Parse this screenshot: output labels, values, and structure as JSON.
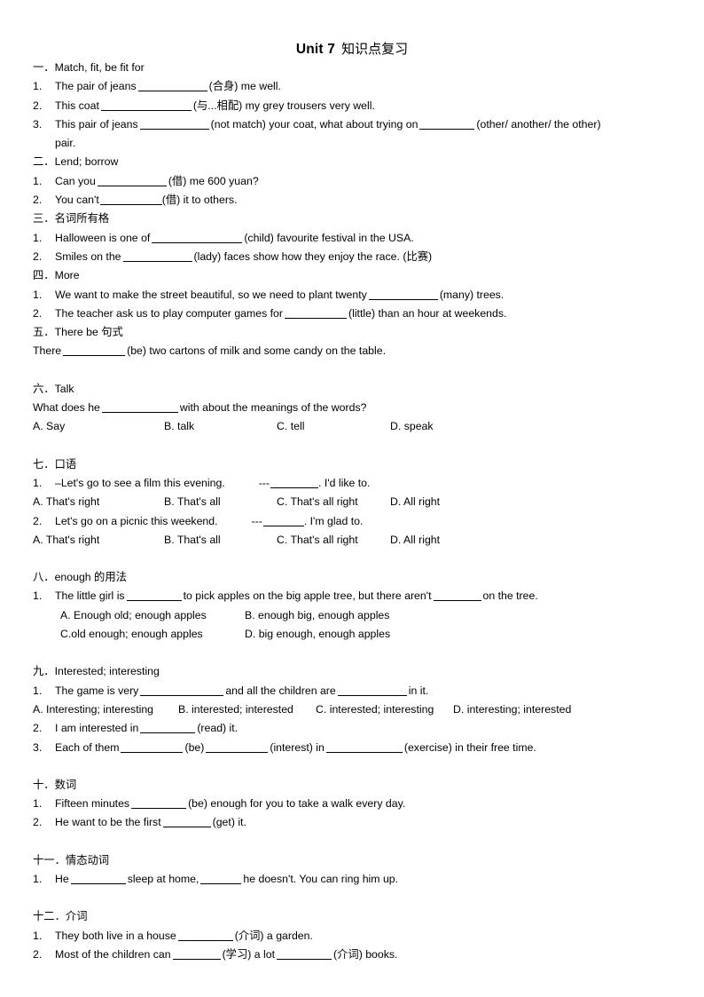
{
  "title": {
    "en": "Unit 7",
    "cn": "知识点复习"
  },
  "sections": [
    {
      "id": "sec-1",
      "heading": "一．Match, fit, be fit for",
      "items": [
        {
          "num": "1.",
          "pre": "The pair of jeans",
          "post": "(合身) me well.",
          "blank": "b10"
        },
        {
          "num": "2.",
          "pre": "This coat",
          "post": "(与...相配) my grey trousers very well.",
          "blank": "b13"
        },
        {
          "num": "3.",
          "pre": "This pair of jeans",
          "mid": "(not match) your coat, what about trying on",
          "post": "(other/ another/ the other)",
          "wrap": "pair.",
          "blank": "b10",
          "blank2": "b8"
        }
      ]
    },
    {
      "id": "sec-2",
      "heading": "二．Lend; borrow",
      "items": [
        {
          "num": "1.",
          "pre": "Can you",
          "post": "(借) me 600 yuan?",
          "blank": "b10"
        },
        {
          "num": "2.",
          "pre": "You can't",
          "post": "(借) it to others.",
          "blank": "b9"
        }
      ]
    },
    {
      "id": "sec-3",
      "heading": "三．名词所有格",
      "items": [
        {
          "num": "1.",
          "pre": "Halloween is one of",
          "post": "(child) favourite festival in the USA.",
          "blank": "b13"
        },
        {
          "num": "2.",
          "pre": "Smiles on the",
          "post": "(lady) faces show how they enjoy the race. (比赛)",
          "blank": "b10"
        }
      ]
    },
    {
      "id": "sec-4",
      "heading": "四．More",
      "items": [
        {
          "num": "1.",
          "pre": "We want to make the street beautiful, so we need to plant twenty",
          "post": "(many) trees.",
          "blank": "b10"
        },
        {
          "num": "2.",
          "pre": "The teacher ask us to play computer games for",
          "post": "(little) than an hour at weekends.",
          "blank": "b9"
        }
      ]
    },
    {
      "id": "sec-5",
      "heading": "五．There be 句式",
      "plain": {
        "pre": "There",
        "post": "(be) two cartons of milk and some candy on the table.",
        "blank": "b9"
      }
    },
    {
      "id": "sec-6",
      "heading": "六．Talk",
      "plain": {
        "pre": "What does he",
        "post": "with about the meanings of the words?",
        "blank": "b11"
      },
      "options": [
        "A.  Say",
        "B. talk",
        "C. tell",
        "D. speak"
      ]
    },
    {
      "id": "sec-7",
      "heading": "七．口语",
      "q1": {
        "num": "1.",
        "pre": "–Let's go to see a film this evening.",
        "dash": "---",
        "post": ". I'd like to.",
        "blank": "b7"
      },
      "options1": [
        "A.  That's right",
        "B. That's all",
        "C. That's all right",
        "D. All right"
      ],
      "q2": {
        "num": "2.",
        "pre": "Let's go on a picnic this weekend.",
        "dash": "---",
        "post": ". I'm glad to.",
        "blank": "b6"
      },
      "options2": [
        "A.  That's right",
        "B. That's all",
        "C. That's all right",
        "D. All right"
      ]
    },
    {
      "id": "sec-8",
      "heading": "八．enough 的用法",
      "q1": {
        "num": "1.",
        "pre": "The little girl is",
        "mid": "to pick apples on the big apple tree, but there aren't",
        "post": "on the tree.",
        "blank": "b8",
        "blank2": "b7"
      },
      "opt_row1_left": "A.  Enough old; enough apples",
      "opt_row1_right": "B. enough big, enough apples",
      "opt_row2_left": "C.old enough; enough apples",
      "opt_row2_right": "D. big enough, enough apples"
    },
    {
      "id": "sec-9",
      "heading": "九．Interested; interesting",
      "q1": {
        "num": "1.",
        "pre": "The game is very",
        "mid": "and all the children are",
        "post": "in it.",
        "blank": "b12",
        "blank2": "b10"
      },
      "options": [
        "A.  Interesting; interesting",
        "B. interested; interested",
        "C. interested; interesting",
        "D. interesting; interested"
      ],
      "q2": {
        "num": "2.",
        "pre": "I am interested in",
        "post": "(read) it.",
        "blank": "b8"
      },
      "q3": {
        "num": "3.",
        "pre": "Each of them",
        "mid": "(be)",
        "mid2": "(interest) in",
        "post": "(exercise) in their free time.",
        "blank": "b9",
        "blank2": "b9",
        "blank3": "b11"
      }
    },
    {
      "id": "sec-10",
      "heading": "十．数词",
      "items": [
        {
          "num": "1.",
          "pre": "Fifteen minutes",
          "post": "(be) enough for you to take a walk every day.",
          "blank": "b8"
        },
        {
          "num": "2.",
          "pre": "He want to be the first",
          "post": "(get) it.",
          "blank": "b7"
        }
      ]
    },
    {
      "id": "sec-11",
      "heading": "十一．情态动词",
      "items": [
        {
          "num": "1.",
          "pre": "He",
          "mid": "sleep at home,",
          "post": "he doesn't. You can ring him up.",
          "blank": "b8",
          "blank2": "b6"
        }
      ]
    },
    {
      "id": "sec-12",
      "heading": "十二．介词",
      "items": [
        {
          "num": "1.",
          "pre": "They both live in a house",
          "post": "(介词) a garden.",
          "blank": "b8"
        },
        {
          "num": "2.",
          "pre": "Most of the children can",
          "mid": "(学习) a lot",
          "post": "(介词) books.",
          "blank": "b7",
          "blank2": "b8"
        }
      ]
    }
  ]
}
